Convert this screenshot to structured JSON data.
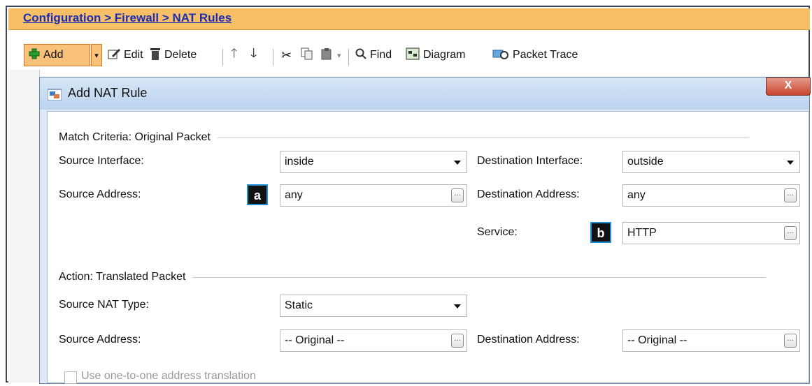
{
  "breadcrumb": "Configuration > Firewall > NAT Rules",
  "toolbar": {
    "add": "Add",
    "edit": "Edit",
    "delete": "Delete",
    "find": "Find",
    "diagram": "Diagram",
    "packet_trace": "Packet Trace"
  },
  "dialog": {
    "title": "Add NAT Rule",
    "close": "X",
    "match": {
      "heading": "Match Criteria: Original Packet",
      "source_interface_label": "Source Interface:",
      "source_interface_value": "inside",
      "destination_interface_label": "Destination Interface:",
      "destination_interface_value": "outside",
      "source_address_label": "Source Address:",
      "source_address_value": "any",
      "destination_address_label": "Destination Address:",
      "destination_address_value": "any",
      "service_label": "Service:",
      "service_value": "HTTP"
    },
    "action": {
      "heading": "Action: Translated Packet",
      "source_nat_type_label": "Source NAT Type:",
      "source_nat_type_value": "Static",
      "source_address_label": "Source Address:",
      "source_address_value": "-- Original --",
      "destination_address_label": "Destination Address:",
      "destination_address_value": "-- Original --",
      "one_to_one_label": "Use one-to-one address translation"
    }
  },
  "callouts": {
    "a": "a",
    "b": "b"
  },
  "colors": {
    "header_bg": "#f7bf68",
    "link": "#1b2fb0",
    "dialog_bg": "#dfe9f5",
    "callout_border": "#1e90d6"
  }
}
